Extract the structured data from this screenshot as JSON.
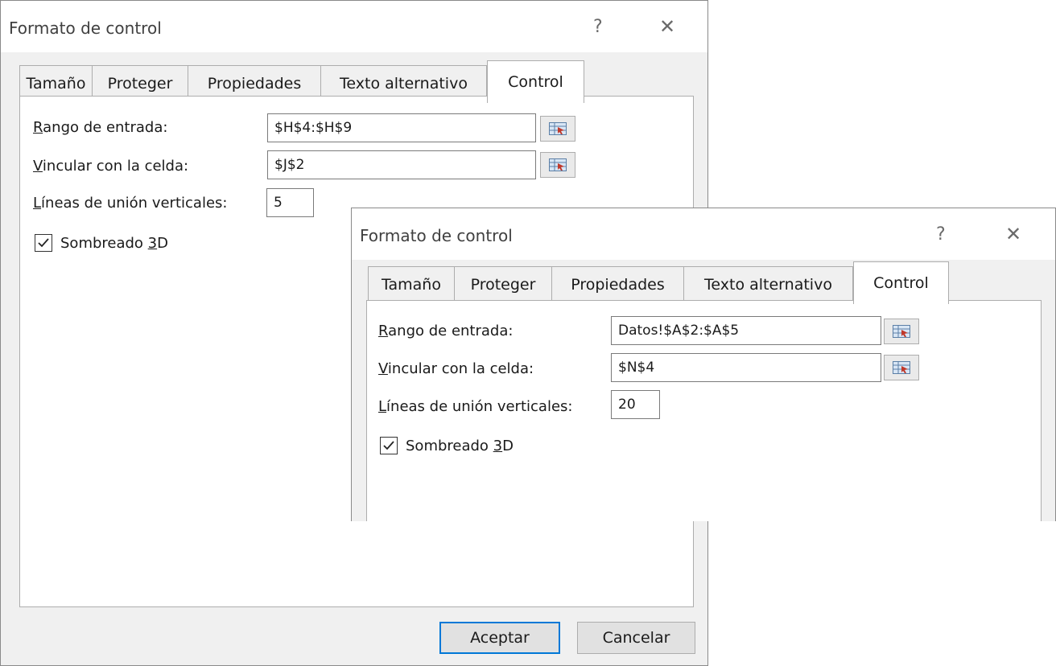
{
  "dialog1": {
    "title": "Formato de control",
    "help": "?",
    "close": "✕",
    "tabs": [
      "Tamaño",
      "Proteger",
      "Propiedades",
      "Texto alternativo",
      "Control"
    ],
    "input_range": {
      "prefix": "R",
      "rest": "ango de entrada:",
      "value": "$H$4:$H$9"
    },
    "cell_link": {
      "prefix": "V",
      "rest": "incular con la celda:",
      "value": "$J$2"
    },
    "drop_lines": {
      "prefix": "L",
      "rest": "íneas de unión verticales:",
      "value": "5"
    },
    "shading": {
      "before": "Sombreado ",
      "accel": "3",
      "after": "D",
      "checked": true
    },
    "ok_label": "Aceptar",
    "cancel_label": "Cancelar"
  },
  "dialog2": {
    "title": "Formato de control",
    "help": "?",
    "close": "✕",
    "tabs": [
      "Tamaño",
      "Proteger",
      "Propiedades",
      "Texto alternativo",
      "Control"
    ],
    "input_range": {
      "prefix": "R",
      "rest": "ango de entrada:",
      "value": "Datos!$A$2:$A$5"
    },
    "cell_link": {
      "prefix": "V",
      "rest": "incular con la celda:",
      "value": "$N$4"
    },
    "drop_lines": {
      "prefix": "L",
      "rest": "íneas de unión verticales:",
      "value": "20"
    },
    "shading": {
      "before": "Sombreado ",
      "accel": "3",
      "after": "D",
      "checked": true
    }
  },
  "icons": {
    "range_picker": "range-select-icon",
    "checkbox": "checkmark-icon"
  }
}
